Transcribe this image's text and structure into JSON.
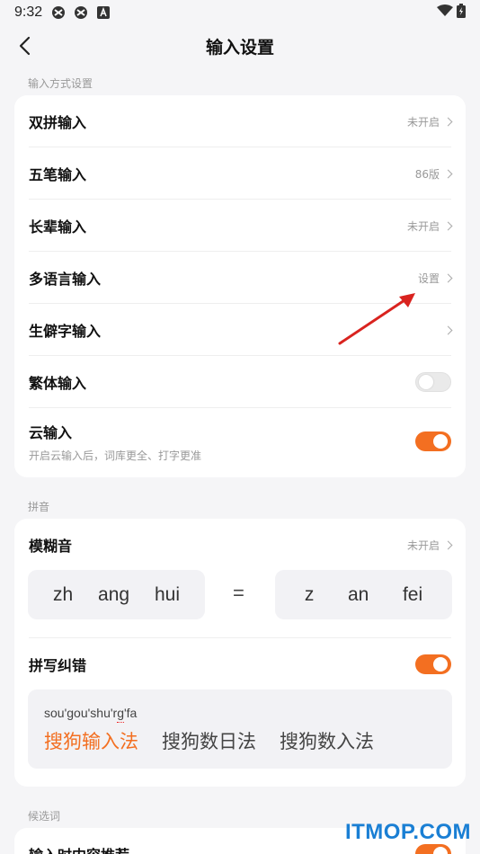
{
  "status": {
    "time": "9:32"
  },
  "header": {
    "title": "输入设置"
  },
  "section1": {
    "label": "输入方式设置",
    "rows": [
      {
        "label": "双拼输入",
        "value": "未开启"
      },
      {
        "label": "五笔输入",
        "value": "86版"
      },
      {
        "label": "长辈输入",
        "value": "未开启"
      },
      {
        "label": "多语言输入",
        "value": "设置"
      },
      {
        "label": "生僻字输入",
        "value": ""
      },
      {
        "label": "繁体输入",
        "toggle": false
      },
      {
        "label": "云输入",
        "sublabel": "开启云输入后，词库更全、打字更准",
        "toggle": true
      }
    ]
  },
  "section2": {
    "label": "拼音",
    "fuzzy": {
      "label": "模糊音",
      "value": "未开启",
      "left": [
        "zh",
        "ang",
        "hui"
      ],
      "equals": "=",
      "right": [
        "z",
        "an",
        "fei"
      ]
    },
    "spell": {
      "label": "拼写纠错",
      "toggle": true,
      "input_before": "sou'gou'shu'r",
      "input_marked": "g",
      "input_after": "'fa",
      "candidates": [
        "搜狗输入法",
        "搜狗数日法",
        "搜狗数入法"
      ]
    }
  },
  "section3": {
    "label": "候选词",
    "row_label": "输入时内容推荐"
  },
  "watermark": "ITMOP.COM",
  "colors": {
    "accent": "#f36f21",
    "arrow": "#d9231f",
    "watermark": "#1a7fd4"
  }
}
